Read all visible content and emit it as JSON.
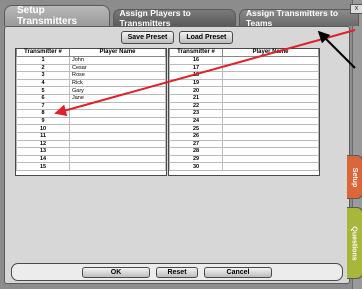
{
  "tabs": [
    {
      "label": "Setup Transmitters"
    },
    {
      "label": "Assign Players to Transmitters"
    },
    {
      "label": "Assign Transmitters to Teams"
    }
  ],
  "toolbar": {
    "save_preset": "Save Preset",
    "load_preset": "Load Preset"
  },
  "table_headers": {
    "transmitter": "Transmitter #",
    "player": "Player Name"
  },
  "left_rows": [
    {
      "num": "1",
      "name": "John"
    },
    {
      "num": "2",
      "name": "Cesar"
    },
    {
      "num": "3",
      "name": "Rose"
    },
    {
      "num": "4",
      "name": "Rick"
    },
    {
      "num": "5",
      "name": "Gary"
    },
    {
      "num": "6",
      "name": "Jane"
    },
    {
      "num": "7",
      "name": ""
    },
    {
      "num": "8",
      "name": ""
    },
    {
      "num": "9",
      "name": ""
    },
    {
      "num": "10",
      "name": ""
    },
    {
      "num": "11",
      "name": ""
    },
    {
      "num": "12",
      "name": ""
    },
    {
      "num": "13",
      "name": ""
    },
    {
      "num": "14",
      "name": ""
    },
    {
      "num": "15",
      "name": ""
    }
  ],
  "right_rows": [
    {
      "num": "16",
      "name": ""
    },
    {
      "num": "17",
      "name": ""
    },
    {
      "num": "18",
      "name": ""
    },
    {
      "num": "19",
      "name": ""
    },
    {
      "num": "20",
      "name": ""
    },
    {
      "num": "21",
      "name": ""
    },
    {
      "num": "22",
      "name": ""
    },
    {
      "num": "23",
      "name": ""
    },
    {
      "num": "24",
      "name": ""
    },
    {
      "num": "25",
      "name": ""
    },
    {
      "num": "26",
      "name": ""
    },
    {
      "num": "27",
      "name": ""
    },
    {
      "num": "28",
      "name": ""
    },
    {
      "num": "29",
      "name": ""
    },
    {
      "num": "30",
      "name": ""
    }
  ],
  "bottom": {
    "ok": "OK",
    "reset": "Reset",
    "cancel": "Cancel"
  },
  "side_tabs": {
    "setup": "Setup",
    "questions": "Questions"
  },
  "close": "x",
  "colors": {
    "setup_tab": "#d9673a",
    "questions_tab": "#a9b63c",
    "arrow_red": "#e0202a",
    "arrow_black": "#000000"
  }
}
